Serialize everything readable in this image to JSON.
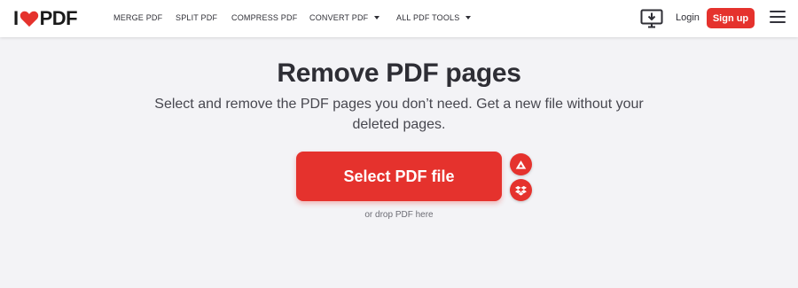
{
  "header": {
    "logo": {
      "left": "I",
      "right": "PDF"
    },
    "nav": [
      {
        "label": "MERGE PDF",
        "has_caret": false
      },
      {
        "label": "SPLIT PDF",
        "has_caret": false
      },
      {
        "label": "COMPRESS PDF",
        "has_caret": false
      },
      {
        "label": "CONVERT PDF",
        "has_caret": true
      },
      {
        "label": "ALL PDF TOOLS",
        "has_caret": true
      }
    ],
    "login_label": "Login",
    "signup_label": "Sign up"
  },
  "main": {
    "title": "Remove PDF pages",
    "subtitle": "Select and remove the PDF pages you don’t need. Get a new file without your deleted pages.",
    "select_button_label": "Select PDF file",
    "drop_hint": "or drop PDF here",
    "cloud_options": [
      {
        "icon": "google-drive-icon"
      },
      {
        "icon": "dropbox-icon"
      }
    ]
  },
  "colors": {
    "brand_red": "#e5322d",
    "background": "#f3f3f6",
    "header_bg": "#ffffff",
    "text_dark": "#2e2e35"
  }
}
